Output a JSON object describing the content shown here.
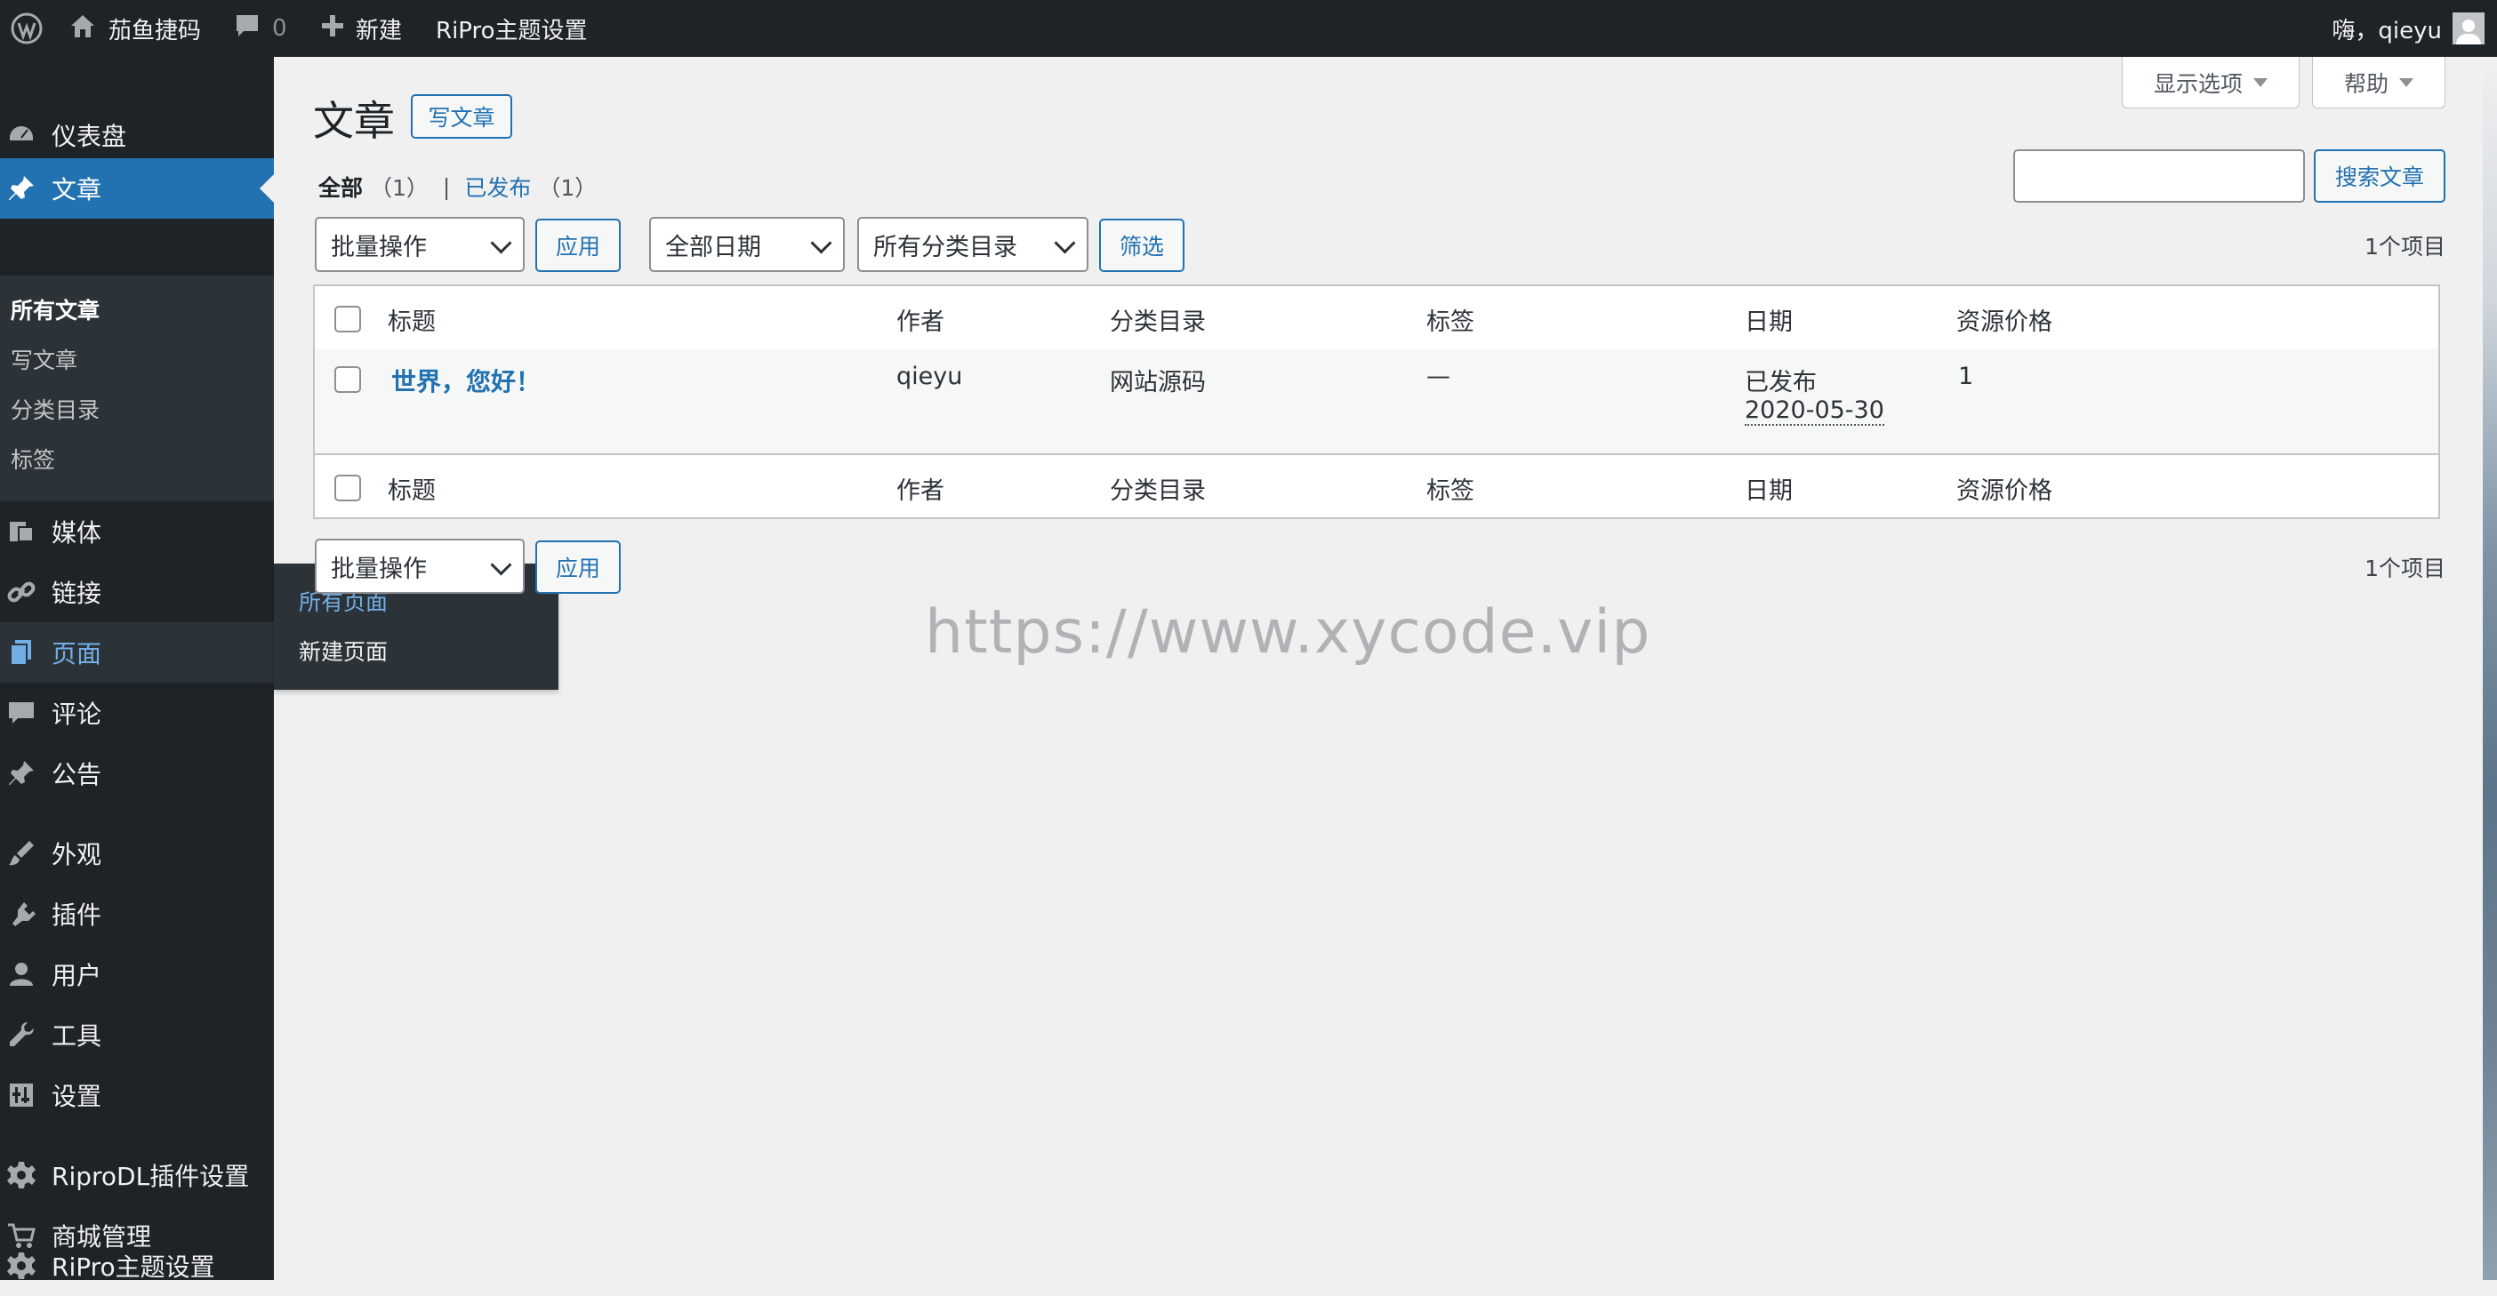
{
  "adminbar": {
    "site_name": "茄鱼捷码",
    "comments_count": "0",
    "new_label": "新建",
    "theme_settings": "RiPro主题设置",
    "greeting": "嗨，qieyu"
  },
  "sidebar": {
    "items": [
      {
        "label": "仪表盘",
        "icon": "dashboard-icon"
      },
      {
        "label": "文章",
        "icon": "pin-icon"
      },
      {
        "label": "媒体",
        "icon": "media-icon"
      },
      {
        "label": "链接",
        "icon": "link-icon"
      },
      {
        "label": "页面",
        "icon": "page-icon"
      },
      {
        "label": "评论",
        "icon": "comment-icon"
      },
      {
        "label": "公告",
        "icon": "pin-icon"
      },
      {
        "label": "外观",
        "icon": "brush-icon"
      },
      {
        "label": "插件",
        "icon": "plugin-icon"
      },
      {
        "label": "用户",
        "icon": "user-icon"
      },
      {
        "label": "工具",
        "icon": "wrench-icon"
      },
      {
        "label": "设置",
        "icon": "settings-icon"
      },
      {
        "label": "RiproDL插件设置",
        "icon": "gear-icon"
      },
      {
        "label": "商城管理",
        "icon": "cart-icon"
      },
      {
        "label": "RiPro主题设置",
        "icon": "gear-icon"
      }
    ],
    "posts_submenu": [
      "所有文章",
      "写文章",
      "分类目录",
      "标签"
    ],
    "pages_flyout": [
      "所有页面",
      "新建页面"
    ]
  },
  "screen_meta": {
    "options": "显示选项",
    "help": "帮助"
  },
  "page": {
    "title": "文章",
    "add_new": "写文章",
    "filter_all": "全部",
    "filter_all_count": "（1）",
    "filter_separator": "|",
    "filter_published": "已发布",
    "filter_published_count": "（1）",
    "search_button": "搜索文章",
    "search_value": "",
    "bulk_action": "批量操作",
    "apply": "应用",
    "all_dates": "全部日期",
    "all_categories": "所有分类目录",
    "filter": "筛选",
    "items_count": "1个项目",
    "bottom_bulk_action": "批量操作"
  },
  "table": {
    "columns": [
      "标题",
      "作者",
      "分类目录",
      "标签",
      "日期",
      "资源价格"
    ],
    "rows": [
      {
        "title": "世界，您好！",
        "author": "qieyu",
        "category": "网站源码",
        "tags": "—",
        "status": "已发布",
        "date": "2020-05-30",
        "price": "1"
      }
    ]
  },
  "watermark": "https://www.xycode.vip",
  "colors": {
    "adminbar_bg": "#1d2327",
    "accent": "#2271b1",
    "hover_link": "#72aee6",
    "page_bg": "#f0f0f1"
  }
}
